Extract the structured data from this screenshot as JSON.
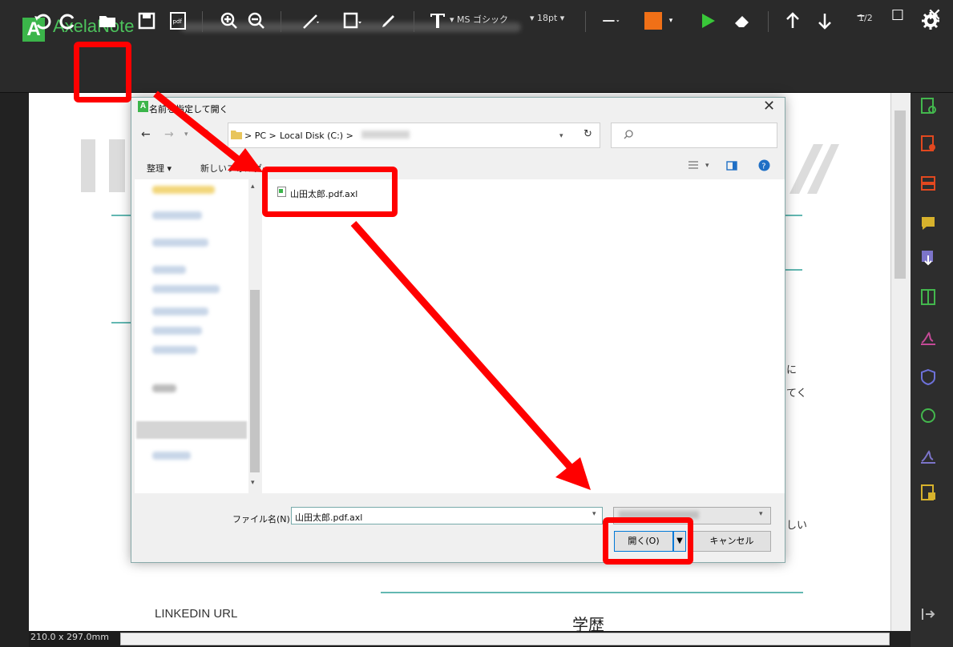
{
  "app": {
    "logo_letter": "A",
    "title": "AxelaNote"
  },
  "window": {
    "minimize": "–",
    "maximize": "☐",
    "close": "✕"
  },
  "toolbar": {
    "font_name": "▾ MS ゴシック",
    "font_size": "▾ 18pt ▾",
    "page_counter": "1/2",
    "stroke_color": "#f07017",
    "play_color": "#39c739"
  },
  "document": {
    "linkedin": "LINKEDIN URL",
    "education": "学歴",
    "frag1": "に",
    "frag2": "てく",
    "frag3": "しい"
  },
  "status": {
    "page_size": "210.0 x 297.0mm"
  },
  "dialog": {
    "logo_letter": "A",
    "title": "名前を指定して開く",
    "close": "✕",
    "breadcrumb_pc": "> PC >",
    "breadcrumb_disk": "Local Disk (C:) >",
    "refresh": "↻",
    "organize": "整理 ▾",
    "new_folder": "新しいフォルダー",
    "file_name": "山田太郎.pdf.axl",
    "file_name_label": "ファイル名(N):",
    "file_name_value": "山田太郎.pdf.axl",
    "open_button": "開く(O)",
    "open_arrow": "▼",
    "cancel_button": "キャンセル"
  },
  "annotation": {
    "highlight_color": "#ff0000"
  }
}
